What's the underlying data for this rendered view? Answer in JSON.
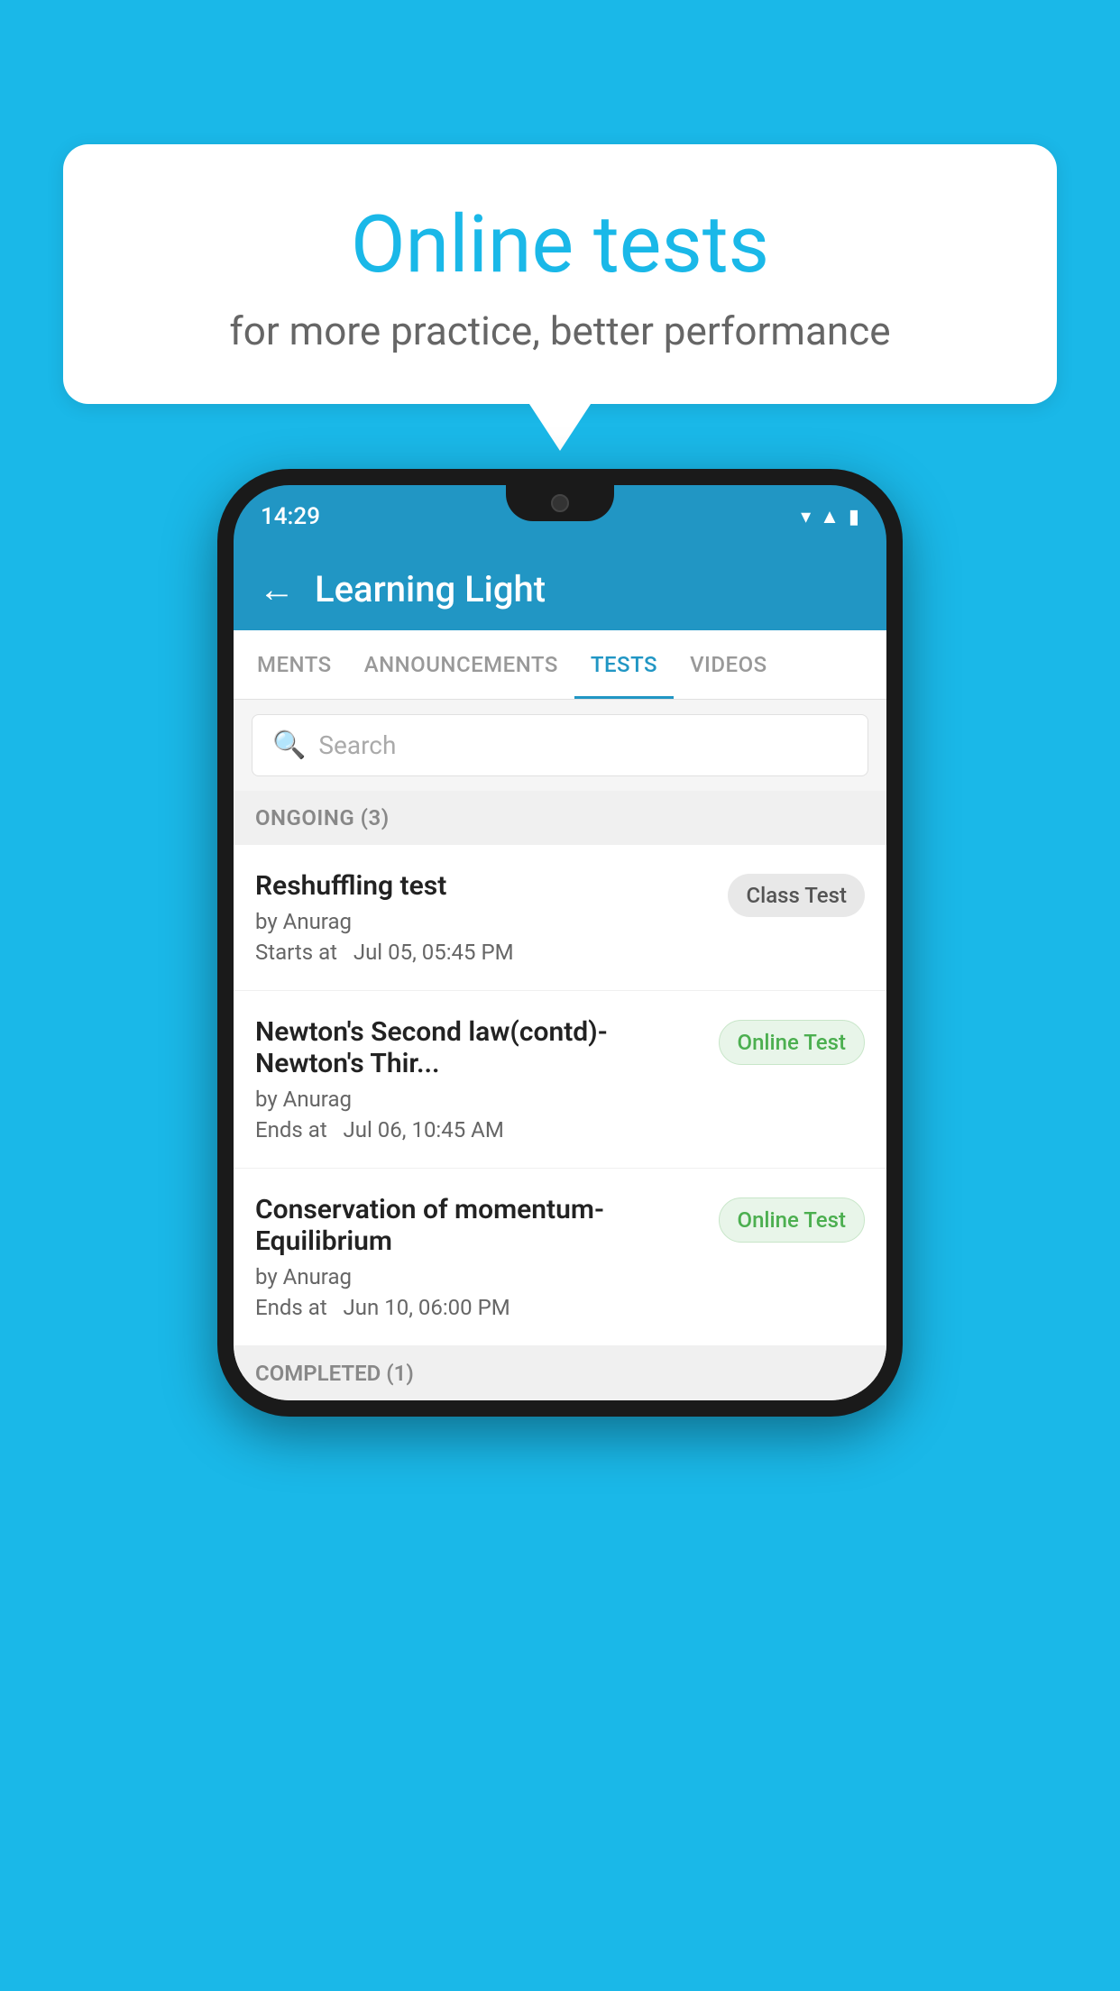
{
  "background_color": "#1ab8e8",
  "speech_bubble": {
    "title": "Online tests",
    "subtitle": "for more practice, better performance"
  },
  "phone": {
    "status_bar": {
      "time": "14:29",
      "icons": [
        "wifi",
        "signal",
        "battery"
      ]
    },
    "app_header": {
      "back_label": "←",
      "title": "Learning Light"
    },
    "tabs": [
      {
        "label": "MENTS",
        "active": false
      },
      {
        "label": "ANNOUNCEMENTS",
        "active": false
      },
      {
        "label": "TESTS",
        "active": true
      },
      {
        "label": "VIDEOS",
        "active": false
      }
    ],
    "search": {
      "placeholder": "Search"
    },
    "sections": [
      {
        "header": "ONGOING (3)",
        "items": [
          {
            "title": "Reshuffling test",
            "author": "by Anurag",
            "date": "Starts at  Jul 05, 05:45 PM",
            "badge": "Class Test",
            "badge_type": "class"
          },
          {
            "title": "Newton's Second law(contd)-Newton's Thir...",
            "author": "by Anurag",
            "date": "Ends at  Jul 06, 10:45 AM",
            "badge": "Online Test",
            "badge_type": "online"
          },
          {
            "title": "Conservation of momentum-Equilibrium",
            "author": "by Anurag",
            "date": "Ends at  Jun 10, 06:00 PM",
            "badge": "Online Test",
            "badge_type": "online"
          }
        ]
      },
      {
        "header": "COMPLETED (1)",
        "items": []
      }
    ]
  }
}
